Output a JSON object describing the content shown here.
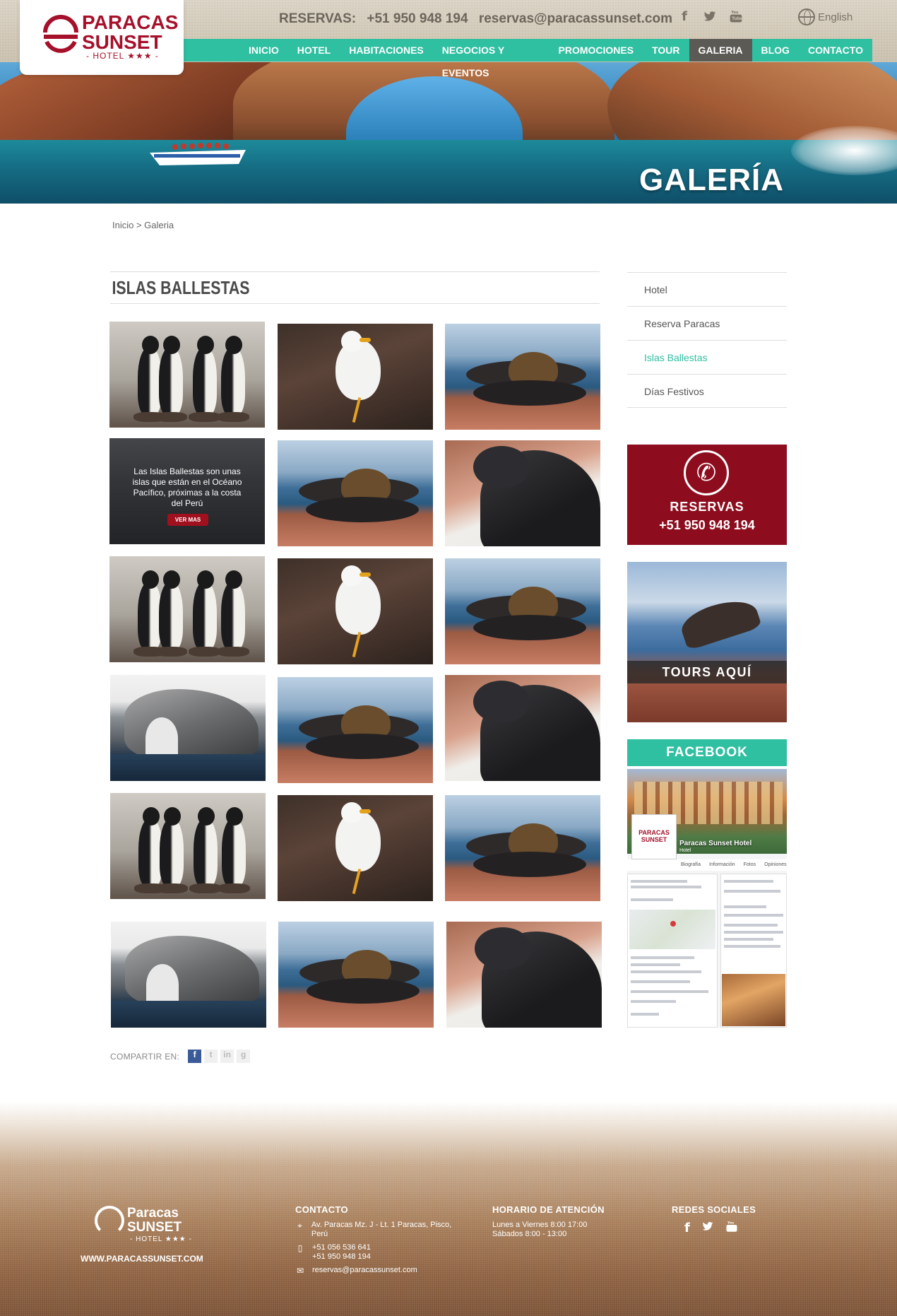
{
  "header": {
    "logo": {
      "line1": "PARACAS",
      "line2": "SUNSET",
      "line3": "- HOTEL ★★★ -"
    },
    "reservas_label": "RESERVAS:",
    "phone": "+51 950 948 194",
    "email": "reservas@paracassunset.com",
    "social_icons": [
      "facebook-icon",
      "twitter-icon",
      "youtube-icon"
    ],
    "language": "English",
    "nav": [
      "INICIO",
      "HOTEL",
      "HABITACIONES",
      "NEGOCIOS Y EVENTOS",
      "PROMOCIONES",
      "TOUR",
      "GALERIA",
      "BLOG",
      "CONTACTO"
    ],
    "nav_active": "GALERIA"
  },
  "hero": {
    "title": "GALERÍA"
  },
  "breadcrumb": "Inicio > Galeria",
  "main": {
    "section_title": "ISLAS BALLESTAS",
    "overlay": {
      "text": "Las Islas Ballestas son unas islas que están en el Océano Pacífico, próximas a la costa del Perú",
      "button": "VER MAS"
    },
    "share_label": "COMPARTIR EN:",
    "share_icons": [
      "f",
      "t",
      "in",
      "g"
    ]
  },
  "sidebar": {
    "menu": [
      "Hotel",
      "Reserva Paracas",
      "Islas Ballestas",
      "Días Festivos"
    ],
    "menu_active": "Islas Ballestas",
    "reservas_box": {
      "title": "RESERVAS",
      "phone": "+51 950 948 194"
    },
    "tours_box": {
      "label": "TOURS AQUÍ"
    },
    "facebook": {
      "title": "FACEBOOK",
      "page_name": "Paracas Sunset Hotel",
      "page_type": "Hotel",
      "tabs": [
        "Biografía",
        "Información",
        "Fotos",
        "Opiniones"
      ]
    }
  },
  "footer": {
    "logo": {
      "line1": "Paracas",
      "line2": "SUNSET",
      "line3": "- HOTEL ★★★ -"
    },
    "url": "WWW.PARACASSUNSET.COM",
    "contacto": {
      "title": "CONTACTO",
      "address": "Av. Paracas Mz. J - Lt. 1 Paracas, Pisco, Perú",
      "phone1": "+51 056 536 641",
      "phone2": "+51 950 948 194",
      "email": "reservas@paracassunset.com"
    },
    "horario": {
      "title": "HORARIO DE ATENCIÓN",
      "line1": "Lunes a Viernes 8:00 17:00",
      "line2": "Sábados 8:00 - 13:00"
    },
    "redes": {
      "title": "REDES SOCIALES"
    }
  },
  "colors": {
    "brand_red": "#a5102a",
    "accent_teal": "#2fbfa1",
    "nav_active_bg": "#5c5a55",
    "reservas_box": "#8d0d1e"
  }
}
